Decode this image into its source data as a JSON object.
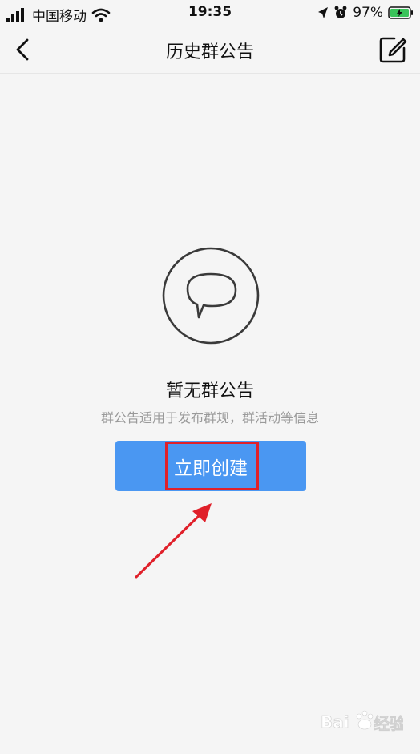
{
  "status_bar": {
    "carrier": "中国移动",
    "time": "19:35",
    "battery": "97%"
  },
  "nav": {
    "title": "历史群公告"
  },
  "empty_state": {
    "title": "暂无群公告",
    "description": "群公告适用于发布群规，群活动等信息",
    "button_label": "立即创建"
  },
  "watermark": {
    "brand_text": "Bai",
    "suffix_text": "经验"
  },
  "colors": {
    "accent": "#4a97f2",
    "highlight": "#e0202a",
    "background": "#f5f5f5"
  }
}
